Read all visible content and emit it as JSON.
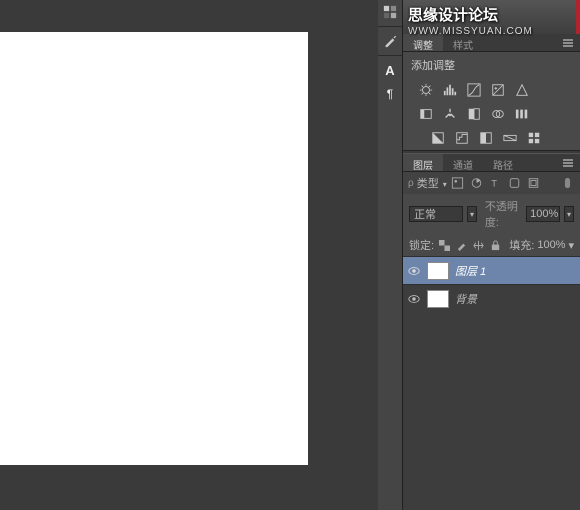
{
  "watermark": {
    "title": "思缘设计论坛",
    "url": "WWW.MISSYUAN.COM"
  },
  "adjustments": {
    "tab_active": "调整",
    "tab_inactive": "样式",
    "title": "添加调整"
  },
  "layers_panel": {
    "tabs": [
      "图层",
      "通道",
      "路径"
    ],
    "filter_label": "类型",
    "blend_mode": "正常",
    "opacity_label": "不透明度:",
    "opacity_value": "100%",
    "lock_label": "锁定:",
    "fill_label": "填充:",
    "fill_value": "100%",
    "items": [
      {
        "name": "图层 1",
        "selected": true
      },
      {
        "name": "背景",
        "selected": false
      }
    ]
  }
}
